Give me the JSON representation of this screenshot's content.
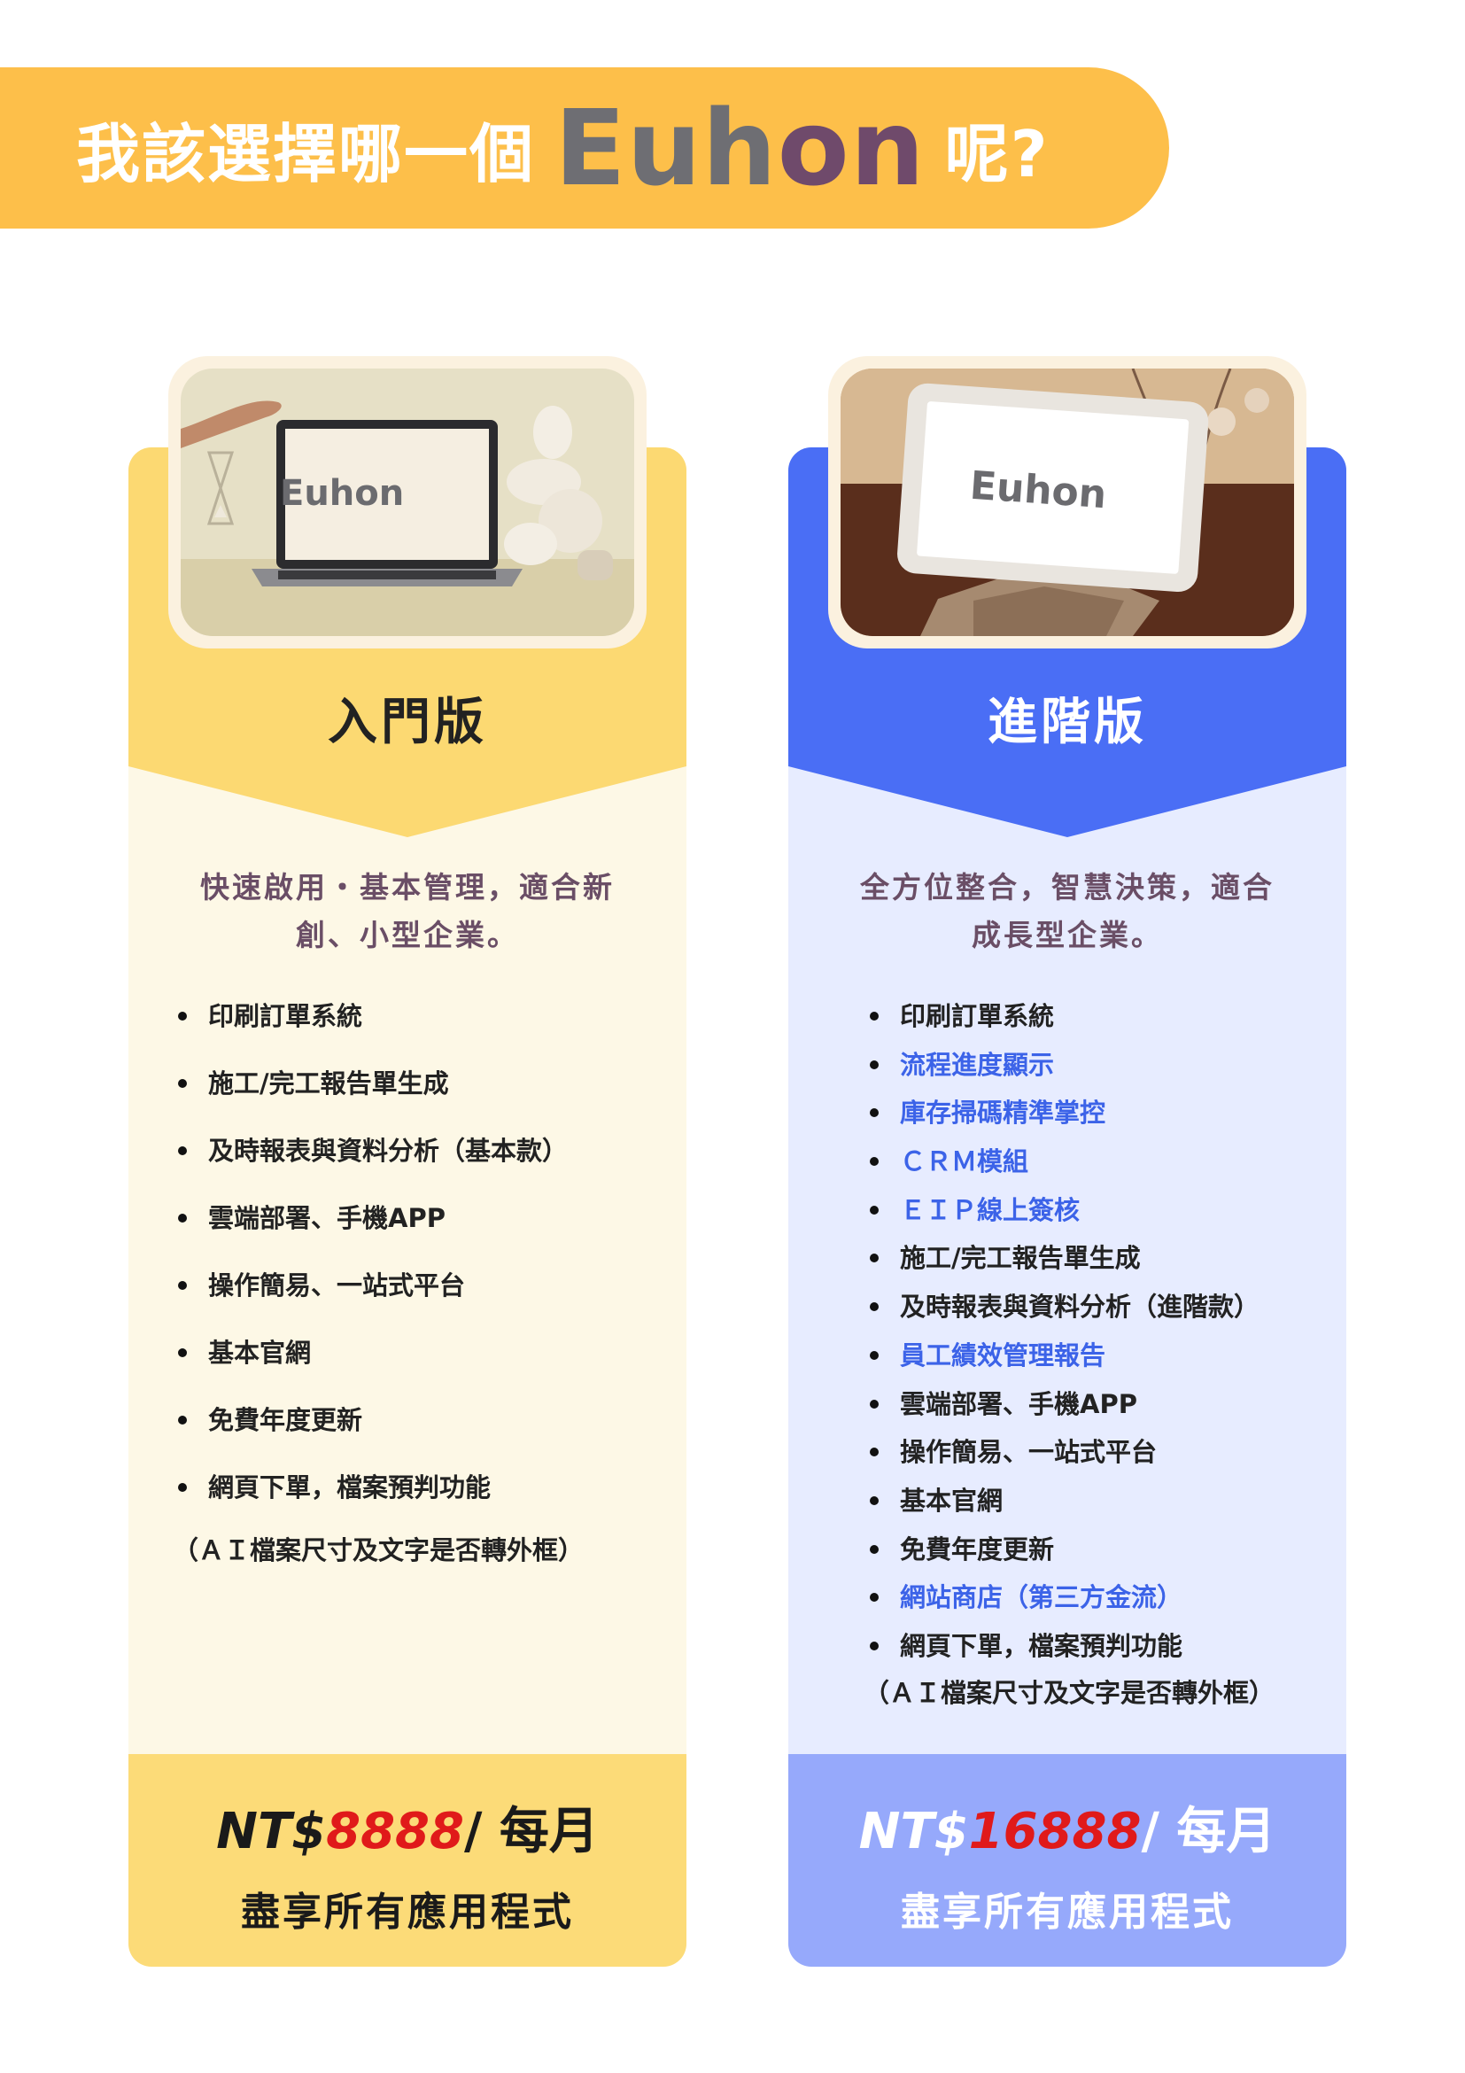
{
  "header": {
    "question_prefix": "我該選擇哪一個",
    "brand_part1": "Euh",
    "brand_part2": "on",
    "question_suffix": "呢?"
  },
  "colors": {
    "banner": "#fdbf4a",
    "basic_accent": "#fcd972",
    "advanced_accent": "#4a6ef5",
    "price_red": "#e01a1a",
    "highlight_blue": "#3c63e8"
  },
  "plans": {
    "basic": {
      "screen_brand": "Euhon",
      "title": "入門版",
      "tagline_line1": "快速啟用・基本管理，適合新",
      "tagline_line2": "創、小型企業。",
      "features": [
        "印刷訂單系統",
        "施工/完工報告單生成",
        "及時報表與資料分析（基本款）",
        "雲端部署、手機APP",
        "操作簡易、一站式平台",
        "基本官網",
        "免費年度更新",
        "網頁下單，檔案預判功能"
      ],
      "note": "（ＡＩ檔案尺寸及文字是否轉外框）",
      "price_prefix": "NT$",
      "price_amount": "8888",
      "price_period": "/ 每月",
      "price_sub": "盡享所有應用程式"
    },
    "advanced": {
      "screen_brand": "Euhon",
      "title": "進階版",
      "tagline_line1": "全方位整合，智慧決策，適合",
      "tagline_line2": "成長型企業。",
      "features": [
        {
          "text": "印刷訂單系統",
          "highlight": false
        },
        {
          "text": "流程進度顯示",
          "highlight": true
        },
        {
          "text": "庫存掃碼精準掌控",
          "highlight": true
        },
        {
          "text": "ＣＲＭ模組",
          "highlight": true
        },
        {
          "text": "ＥＩＰ線上簽核",
          "highlight": true
        },
        {
          "text": "施工/完工報告單生成",
          "highlight": false
        },
        {
          "text": "及時報表與資料分析（進階款）",
          "highlight": false
        },
        {
          "text": "員工績效管理報告",
          "highlight": true
        },
        {
          "text": "雲端部署、手機APP",
          "highlight": false
        },
        {
          "text": "操作簡易、一站式平台",
          "highlight": false
        },
        {
          "text": "基本官網",
          "highlight": false
        },
        {
          "text": "免費年度更新",
          "highlight": false
        },
        {
          "text": "網站商店（第三方金流）",
          "highlight": true
        },
        {
          "text": "網頁下單，檔案預判功能",
          "highlight": false
        }
      ],
      "note": "（ＡＩ檔案尺寸及文字是否轉外框）",
      "price_prefix": "NT$",
      "price_amount": "16888",
      "price_period": "/ 每月",
      "price_sub": "盡享所有應用程式"
    }
  }
}
